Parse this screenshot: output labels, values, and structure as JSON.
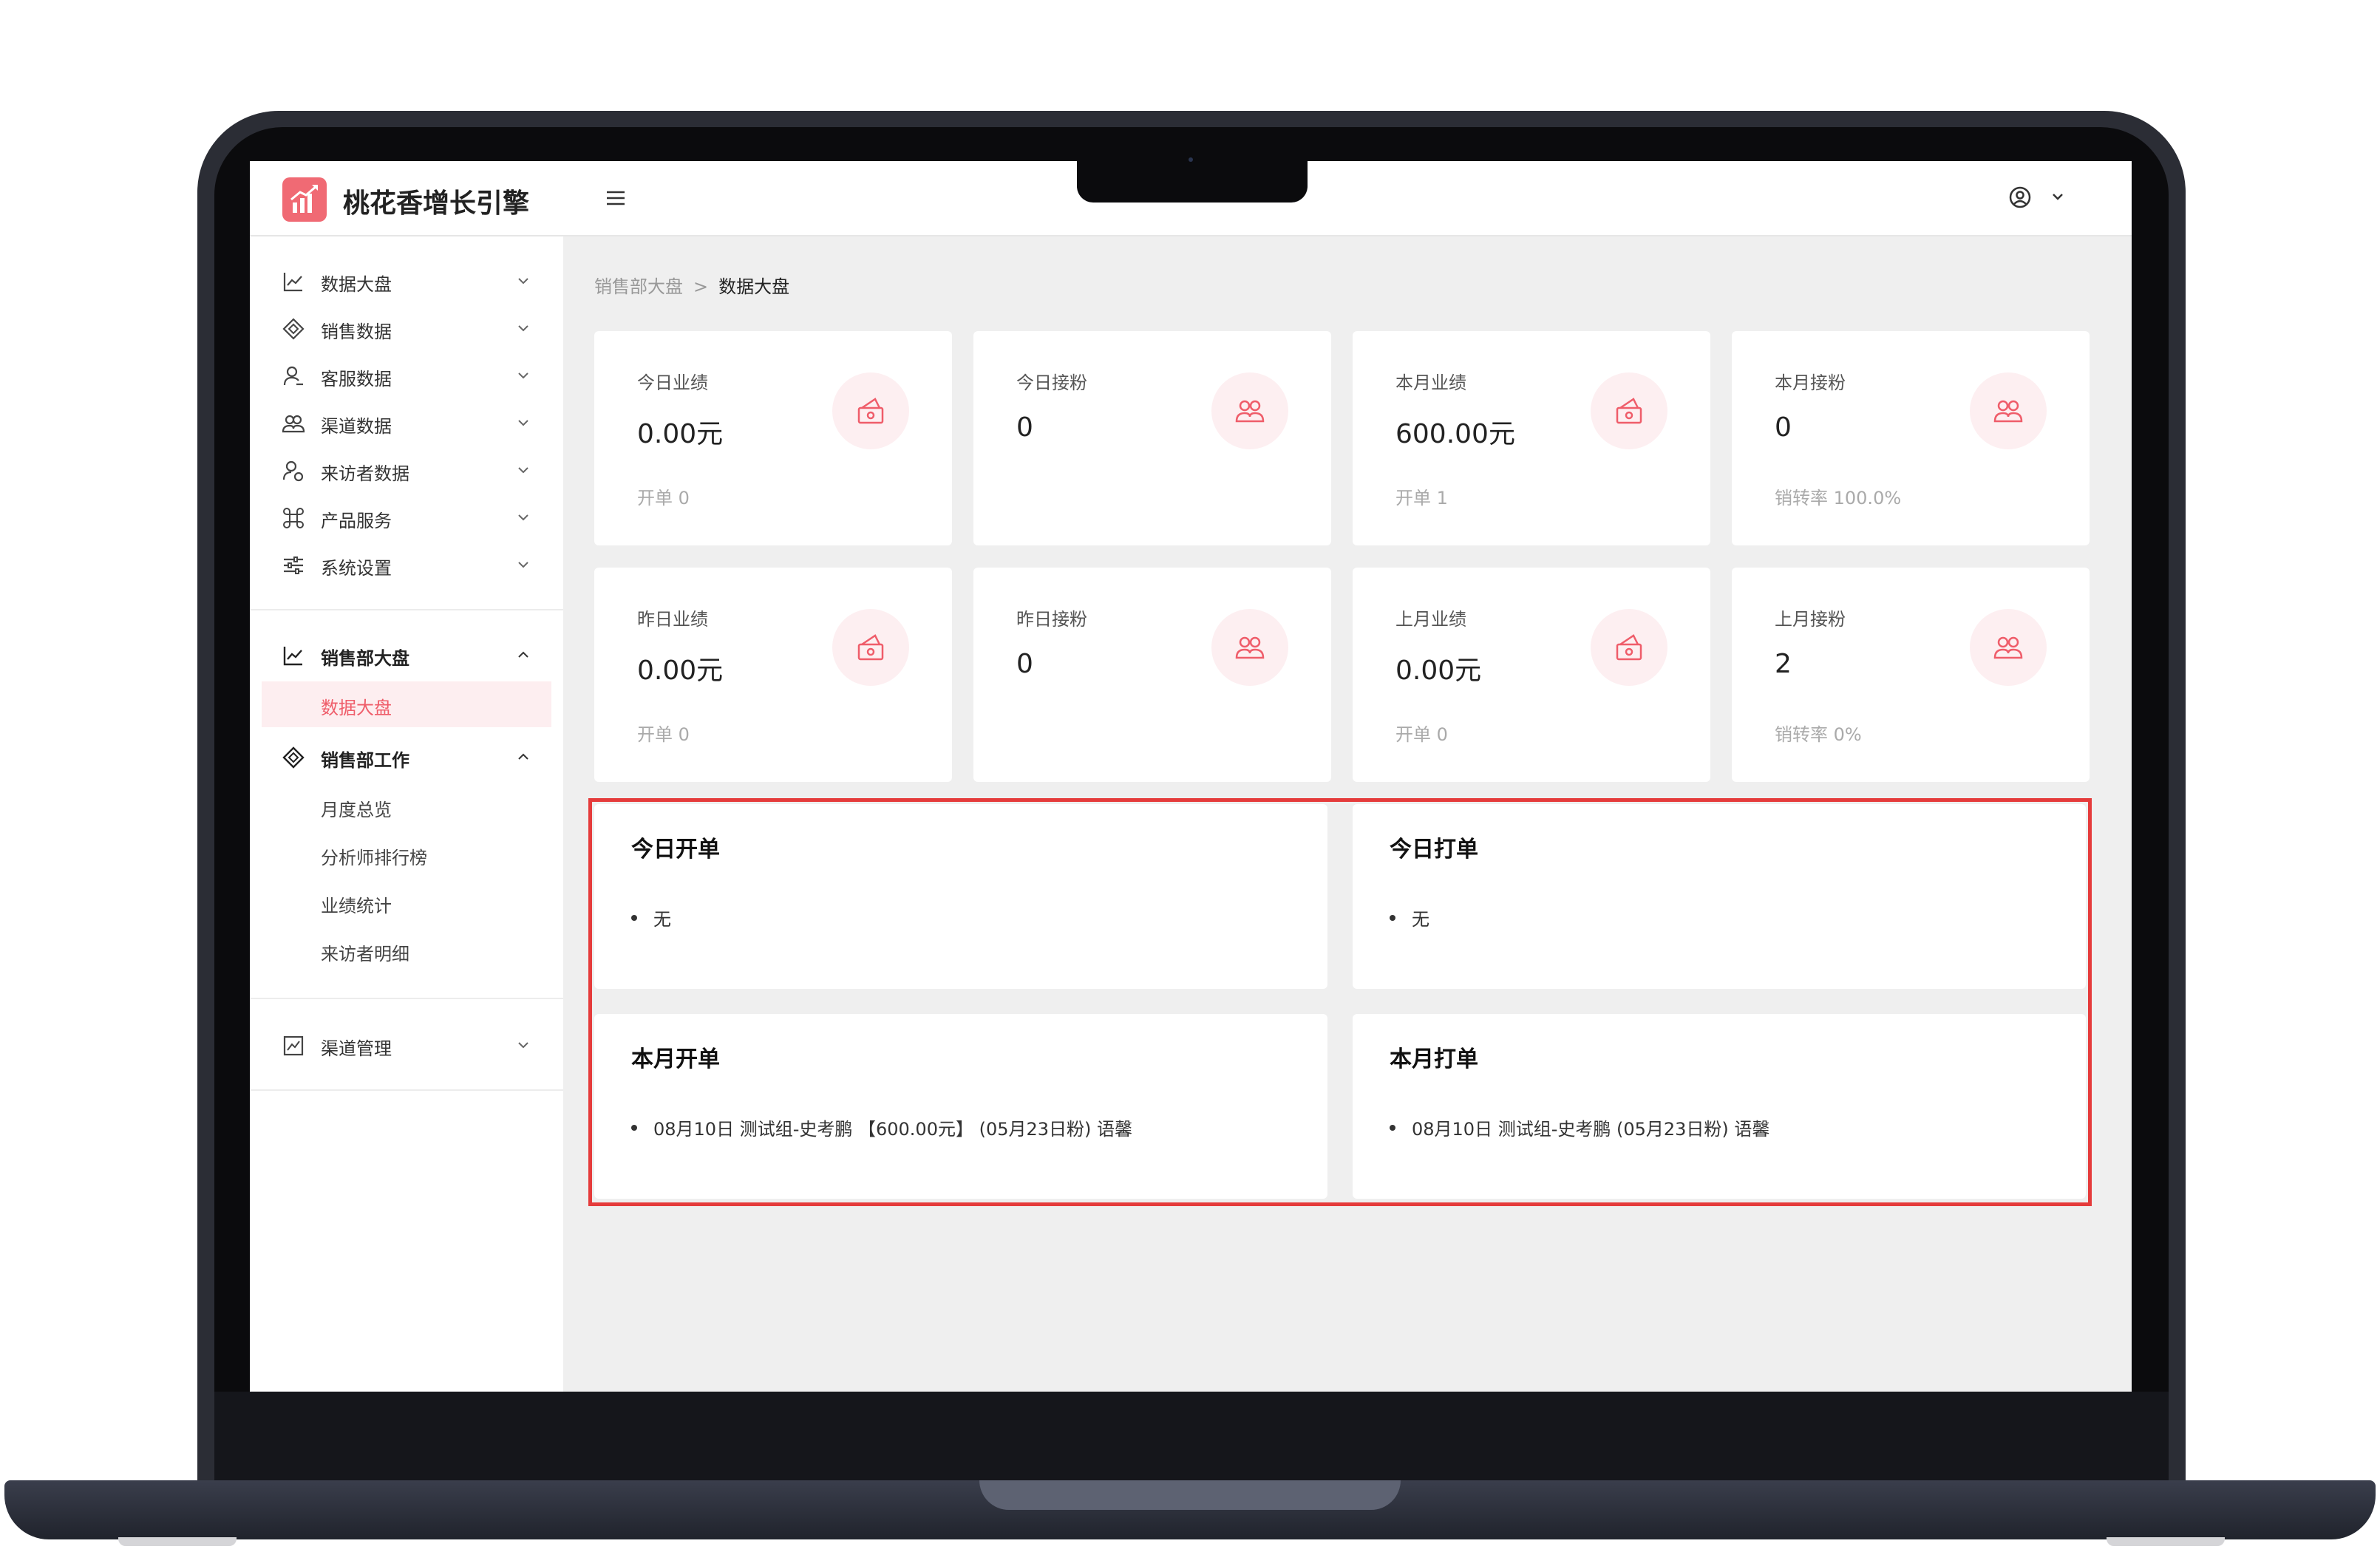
{
  "app": {
    "title": "桃花香增长引擎"
  },
  "sidebar": {
    "top_items": [
      {
        "label": "数据大盘",
        "icon": "line-chart-icon"
      },
      {
        "label": "销售数据",
        "icon": "tag-icon"
      },
      {
        "label": "客服数据",
        "icon": "user-icon"
      },
      {
        "label": "渠道数据",
        "icon": "group-icon"
      },
      {
        "label": "来访者数据",
        "icon": "visitor-icon"
      },
      {
        "label": "产品服务",
        "icon": "command-icon"
      },
      {
        "label": "系统设置",
        "icon": "sliders-icon"
      }
    ],
    "sales_board": {
      "label": "销售部大盘",
      "sub_items": [
        "数据大盘"
      ]
    },
    "sales_work": {
      "label": "销售部工作",
      "sub_items": [
        "月度总览",
        "分析师排行榜",
        "业绩统计",
        "来访者明细"
      ]
    },
    "channel": {
      "label": "渠道管理"
    }
  },
  "breadcrumb": {
    "parent": "销售部大盘",
    "separator": ">",
    "current": "数据大盘"
  },
  "stats": [
    {
      "title": "今日业绩",
      "value": "0.00元",
      "sub": "开单 0",
      "icon": "money-icon"
    },
    {
      "title": "今日接粉",
      "value": "0",
      "sub": "",
      "icon": "users-icon"
    },
    {
      "title": "本月业绩",
      "value": "600.00元",
      "sub": "开单 1",
      "icon": "money-icon"
    },
    {
      "title": "本月接粉",
      "value": "0",
      "sub": "销转率 100.0%",
      "icon": "users-icon"
    },
    {
      "title": "昨日业绩",
      "value": "0.00元",
      "sub": "开单 0",
      "icon": "money-icon"
    },
    {
      "title": "昨日接粉",
      "value": "0",
      "sub": "",
      "icon": "users-icon"
    },
    {
      "title": "上月业绩",
      "value": "0.00元",
      "sub": "开单 0",
      "icon": "money-icon"
    },
    {
      "title": "上月接粉",
      "value": "2",
      "sub": "销转率 0%",
      "icon": "users-icon"
    }
  ],
  "panels": [
    {
      "title": "今日开单",
      "item": "无"
    },
    {
      "title": "今日打单",
      "item": "无"
    },
    {
      "title": "本月开单",
      "item": "08月10日 测试组-史考鹏 【600.00元】 (05月23日粉) 语馨"
    },
    {
      "title": "本月打单",
      "item": "08月10日 测试组-史考鹏 (05月23日粉) 语馨"
    }
  ],
  "colors": {
    "accent": "#ef5d6a",
    "highlight": "#e53b3b",
    "icon_bg": "#fdeff1"
  }
}
